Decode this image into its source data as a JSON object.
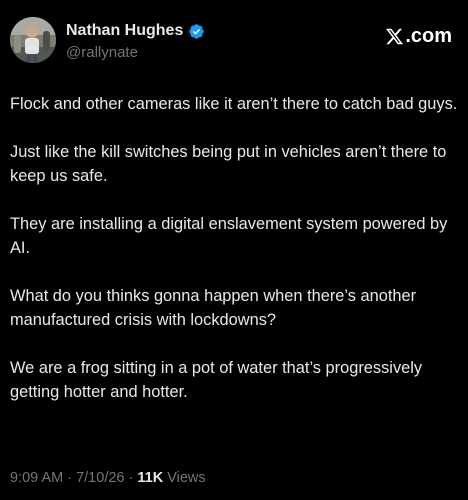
{
  "author": {
    "display_name": "Nathan Hughes",
    "handle": "@rallynate",
    "verified": true,
    "avatar_icon": "profile-photo"
  },
  "brand": {
    "suffix": ".com",
    "logo_icon": "x-logo-icon"
  },
  "post": {
    "paragraphs": [
      "Flock and other cameras like it aren’t there to catch bad guys.",
      "Just like the kill switches being put in vehicles aren’t there to keep us safe.",
      "They are installing a digital enslavement system powered by AI.",
      "What do you thinks gonna happen when there’s another manufactured crisis with lockdowns?",
      "We are a frog sitting in a pot of water that’s progressively getting hotter and hotter."
    ]
  },
  "meta": {
    "time": "9:09 AM",
    "separator": " · ",
    "date": "7/10/26",
    "views_count": "11K",
    "views_label": " Views"
  },
  "colors": {
    "background": "#000000",
    "text": "#e7e9ea",
    "secondary": "#71767b",
    "verified_badge": "#1d9bf0"
  }
}
